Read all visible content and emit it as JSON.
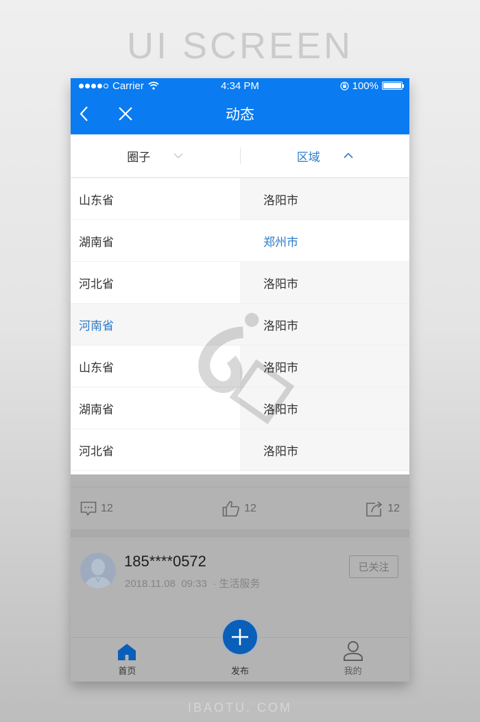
{
  "banner": {
    "title": "UI SCREEN",
    "footer": "IBAOTU. COM"
  },
  "status_bar": {
    "carrier": "Carrier",
    "time": "4:34 PM",
    "battery": "100%",
    "signal_bars_filled": 4,
    "signal_bars_total": 5
  },
  "nav": {
    "title": "动态",
    "back_icon": "chevron-left-icon",
    "close_icon": "close-icon"
  },
  "filters": [
    {
      "label": "圈子",
      "icon": "chevron-down-icon",
      "active": false
    },
    {
      "label": "区域",
      "icon": "chevron-up-icon",
      "active": true
    }
  ],
  "provinces": [
    {
      "label": "山东省",
      "selected": false
    },
    {
      "label": "湖南省",
      "selected": false
    },
    {
      "label": "河北省",
      "selected": false
    },
    {
      "label": "河南省",
      "selected": true
    },
    {
      "label": "山东省",
      "selected": false
    },
    {
      "label": "湖南省",
      "selected": false
    },
    {
      "label": "河北省",
      "selected": false
    }
  ],
  "cities": [
    {
      "label": "洛阳市",
      "selected": false
    },
    {
      "label": "郑州市",
      "selected": true
    },
    {
      "label": "洛阳市",
      "selected": false
    },
    {
      "label": "洛阳市",
      "selected": false
    },
    {
      "label": "洛阳市",
      "selected": false
    },
    {
      "label": "洛阳市",
      "selected": false
    },
    {
      "label": "洛阳市",
      "selected": false
    }
  ],
  "actions": {
    "comments": "12",
    "likes": "12",
    "shares": "12"
  },
  "post": {
    "username": "185****0572",
    "date": "2018.11.08",
    "time": "09:33",
    "category": "· 生活服务",
    "follow_label": "已关注"
  },
  "tabbar": {
    "home": "首页",
    "publish": "发布",
    "mine": "我的"
  },
  "colors": {
    "primary": "#0a7bf0",
    "accent_text": "#2a7ac9",
    "fab": "#0a5fb9"
  }
}
